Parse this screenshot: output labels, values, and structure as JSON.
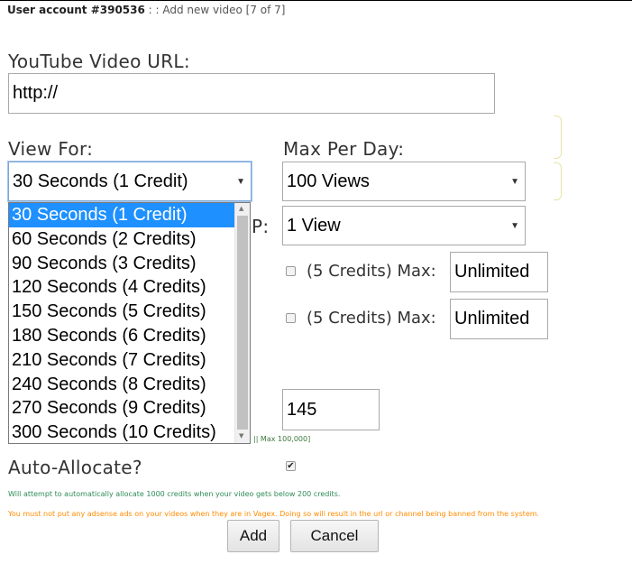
{
  "breadcrumb": {
    "account": "User account #390536",
    "separator": " : : ",
    "page": "Add new video [7 of 7]"
  },
  "youtube_url": {
    "label": "YouTube Video URL:",
    "value": "http://"
  },
  "view_for": {
    "label": "View For:",
    "selected": "30 Seconds (1 Credit)",
    "options": [
      "30 Seconds (1 Credit)",
      "60 Seconds (2 Credits)",
      "90 Seconds (3 Credits)",
      "120 Seconds (4 Credits)",
      "150 Seconds (5 Credits)",
      "180 Seconds (6 Credits)",
      "210 Seconds (7 Credits)",
      "240 Seconds (8 Credits)",
      "270 Seconds (9 Credits)",
      "300 Seconds (10 Credits)"
    ]
  },
  "max_per_day": {
    "label": "Max Per Day:",
    "selected": "100 Views"
  },
  "per_ip": {
    "label_fragment": "P:",
    "selected": "1 View"
  },
  "option_rows": [
    {
      "checked": false,
      "label": "(5 Credits) Max:",
      "value": "Unlimited"
    },
    {
      "checked": false,
      "label": "(5 Credits) Max:",
      "value": "Unlimited"
    }
  ],
  "credits": {
    "value": "145",
    "hint": "|| Max 100,000]"
  },
  "auto_allocate": {
    "label": "Auto-Allocate?",
    "checked": true,
    "note": "Will attempt to automatically allocate 1000 credits when your video gets below 200 credits."
  },
  "warning": "You must not put any adsense ads on your videos when they are in Vagex. Doing so will result in the url or channel being banned from the system.",
  "buttons": {
    "add": "Add",
    "cancel": "Cancel"
  },
  "icons": {
    "select_caret": "caret-down-icon",
    "checkmark": "checkmark-icon",
    "scroll_up": "scroll-up-arrow-icon",
    "scroll_down": "scroll-down-arrow-icon"
  },
  "colors": {
    "selected_option": "#1e90ff",
    "note_green": "#2e8b57",
    "note_orange": "#ff8c00"
  }
}
